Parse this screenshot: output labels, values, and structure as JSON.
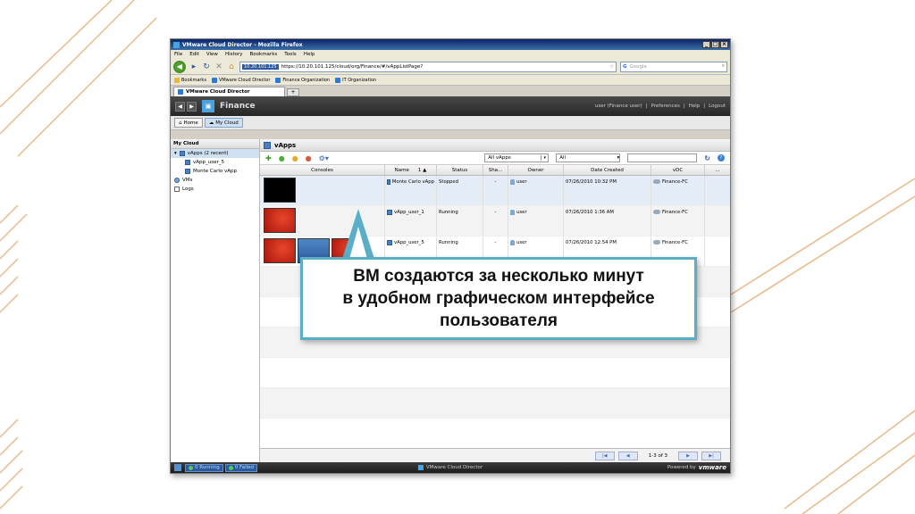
{
  "window": {
    "title": "VMware Cloud Director - Mozilla Firefox",
    "buttons": [
      "_",
      "□",
      "×"
    ]
  },
  "menubar": [
    "File",
    "Edit",
    "View",
    "History",
    "Bookmarks",
    "Tools",
    "Help"
  ],
  "navbar": {
    "site_badge": "10.20.101.125",
    "url": "https://10.20.101.125/cloud/org/Finance/#/vAppListPage?",
    "search_placeholder": "Google"
  },
  "bookmarks": [
    "Bookmarks",
    "VMware Cloud Director",
    "Finance Organization",
    "IT Organization"
  ],
  "browser_tab": {
    "label": "VMware Cloud Director",
    "new_tab": "+"
  },
  "app": {
    "org_name": "Finance",
    "user_nav": [
      "user (Finance user)",
      "|",
      "Preferences",
      "|",
      "Help",
      "|",
      "Logout"
    ],
    "tabs": [
      "Home",
      "My Cloud"
    ]
  },
  "sidebar": {
    "header": "My Cloud",
    "items": [
      {
        "label": "vApps (2 recent)"
      },
      {
        "label": "vApp_user_5"
      },
      {
        "label": "Monte Carlo vApp"
      },
      {
        "label": "VMs"
      },
      {
        "label": "Logs"
      }
    ]
  },
  "main": {
    "title": "vApps",
    "filter1": "All vApps",
    "filter2": "All",
    "columns": [
      "Consoles",
      "Name",
      "1 ▲",
      "Status",
      "Sha...",
      "Owner",
      "Date Created",
      "vDC",
      "..."
    ],
    "rows": [
      {
        "name": "Monte Carlo vApp",
        "status": "Stopped",
        "shared": "-",
        "owner": "user",
        "date": "07/26/2010 10:32 PM",
        "vdc": "Finance-FC"
      },
      {
        "name": "vApp_user_1",
        "status": "Running",
        "shared": "-",
        "owner": "user",
        "date": "07/26/2010 1:36 AM",
        "vdc": "Finance-FC"
      },
      {
        "name": "vApp_user_5",
        "status": "Running",
        "shared": "-",
        "owner": "user",
        "date": "07/26/2010 12:54 PM",
        "vdc": "Finance-FC"
      }
    ],
    "pager": {
      "info": "1-3 of 3"
    }
  },
  "statusbar": {
    "running": "0 Running",
    "failed": "0 Failed",
    "center": "VMware Cloud Director",
    "powered": "Powered by",
    "brand": "vmware"
  },
  "callout": {
    "line1": "ВМ создаются за несколько минут",
    "line2": "в удобном графическом интерфейсе",
    "line3": "пользователя"
  },
  "colors": {
    "callout_border": "#5aaec7",
    "header_dark": "#262626",
    "accent_blue": "#2c5aa0"
  }
}
